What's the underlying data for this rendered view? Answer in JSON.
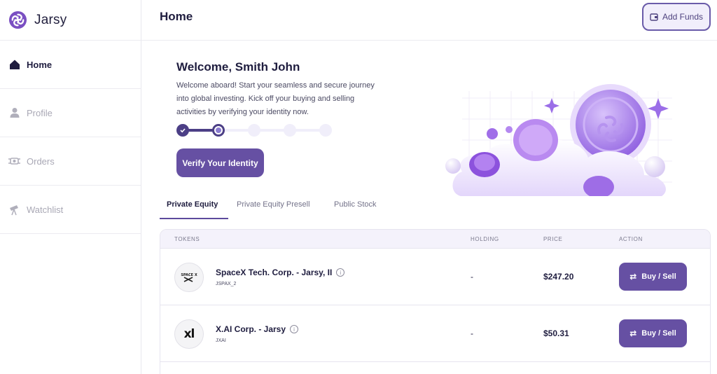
{
  "brand": {
    "name": "Jarsy"
  },
  "sidebar": {
    "items": [
      {
        "label": "Home",
        "icon": "home-icon"
      },
      {
        "label": "Profile",
        "icon": "user-icon"
      },
      {
        "label": "Orders",
        "icon": "orders-icon"
      },
      {
        "label": "Watchlist",
        "icon": "telescope-icon"
      }
    ]
  },
  "header": {
    "title": "Home",
    "add_funds_label": "Add Funds"
  },
  "welcome": {
    "title": "Welcome, Smith John",
    "text": "Welcome aboard! Start your seamless and secure journey into global investing. Kick off your buying and selling activities by verifying your identity now.",
    "verify_label": "Verify Your Identity",
    "steps_total": 5,
    "steps_completed": 1,
    "current_step": 2
  },
  "tabs": [
    {
      "label": "Private Equity",
      "active": true
    },
    {
      "label": "Private Equity Presell",
      "active": false
    },
    {
      "label": "Public Stock",
      "active": false
    }
  ],
  "table": {
    "headers": {
      "tokens": "TOKENS",
      "holding": "HOLDING",
      "price": "PRICE",
      "action": "ACTION"
    },
    "rows": [
      {
        "logo_text": "SPACE X",
        "name": "SpaceX Tech. Corp. - Jarsy, II",
        "ticker": "JSPAX_2",
        "holding": "-",
        "price": "$247.20",
        "action": "Buy / Sell"
      },
      {
        "logo_text": "xl",
        "name": "X.AI Corp. - Jarsy",
        "ticker": "JXAI",
        "holding": "-",
        "price": "$50.31",
        "action": "Buy / Sell"
      }
    ]
  },
  "colors": {
    "accent": "#6650a3",
    "dark": "#1f1d3f",
    "muted": "#a9a8b5"
  }
}
